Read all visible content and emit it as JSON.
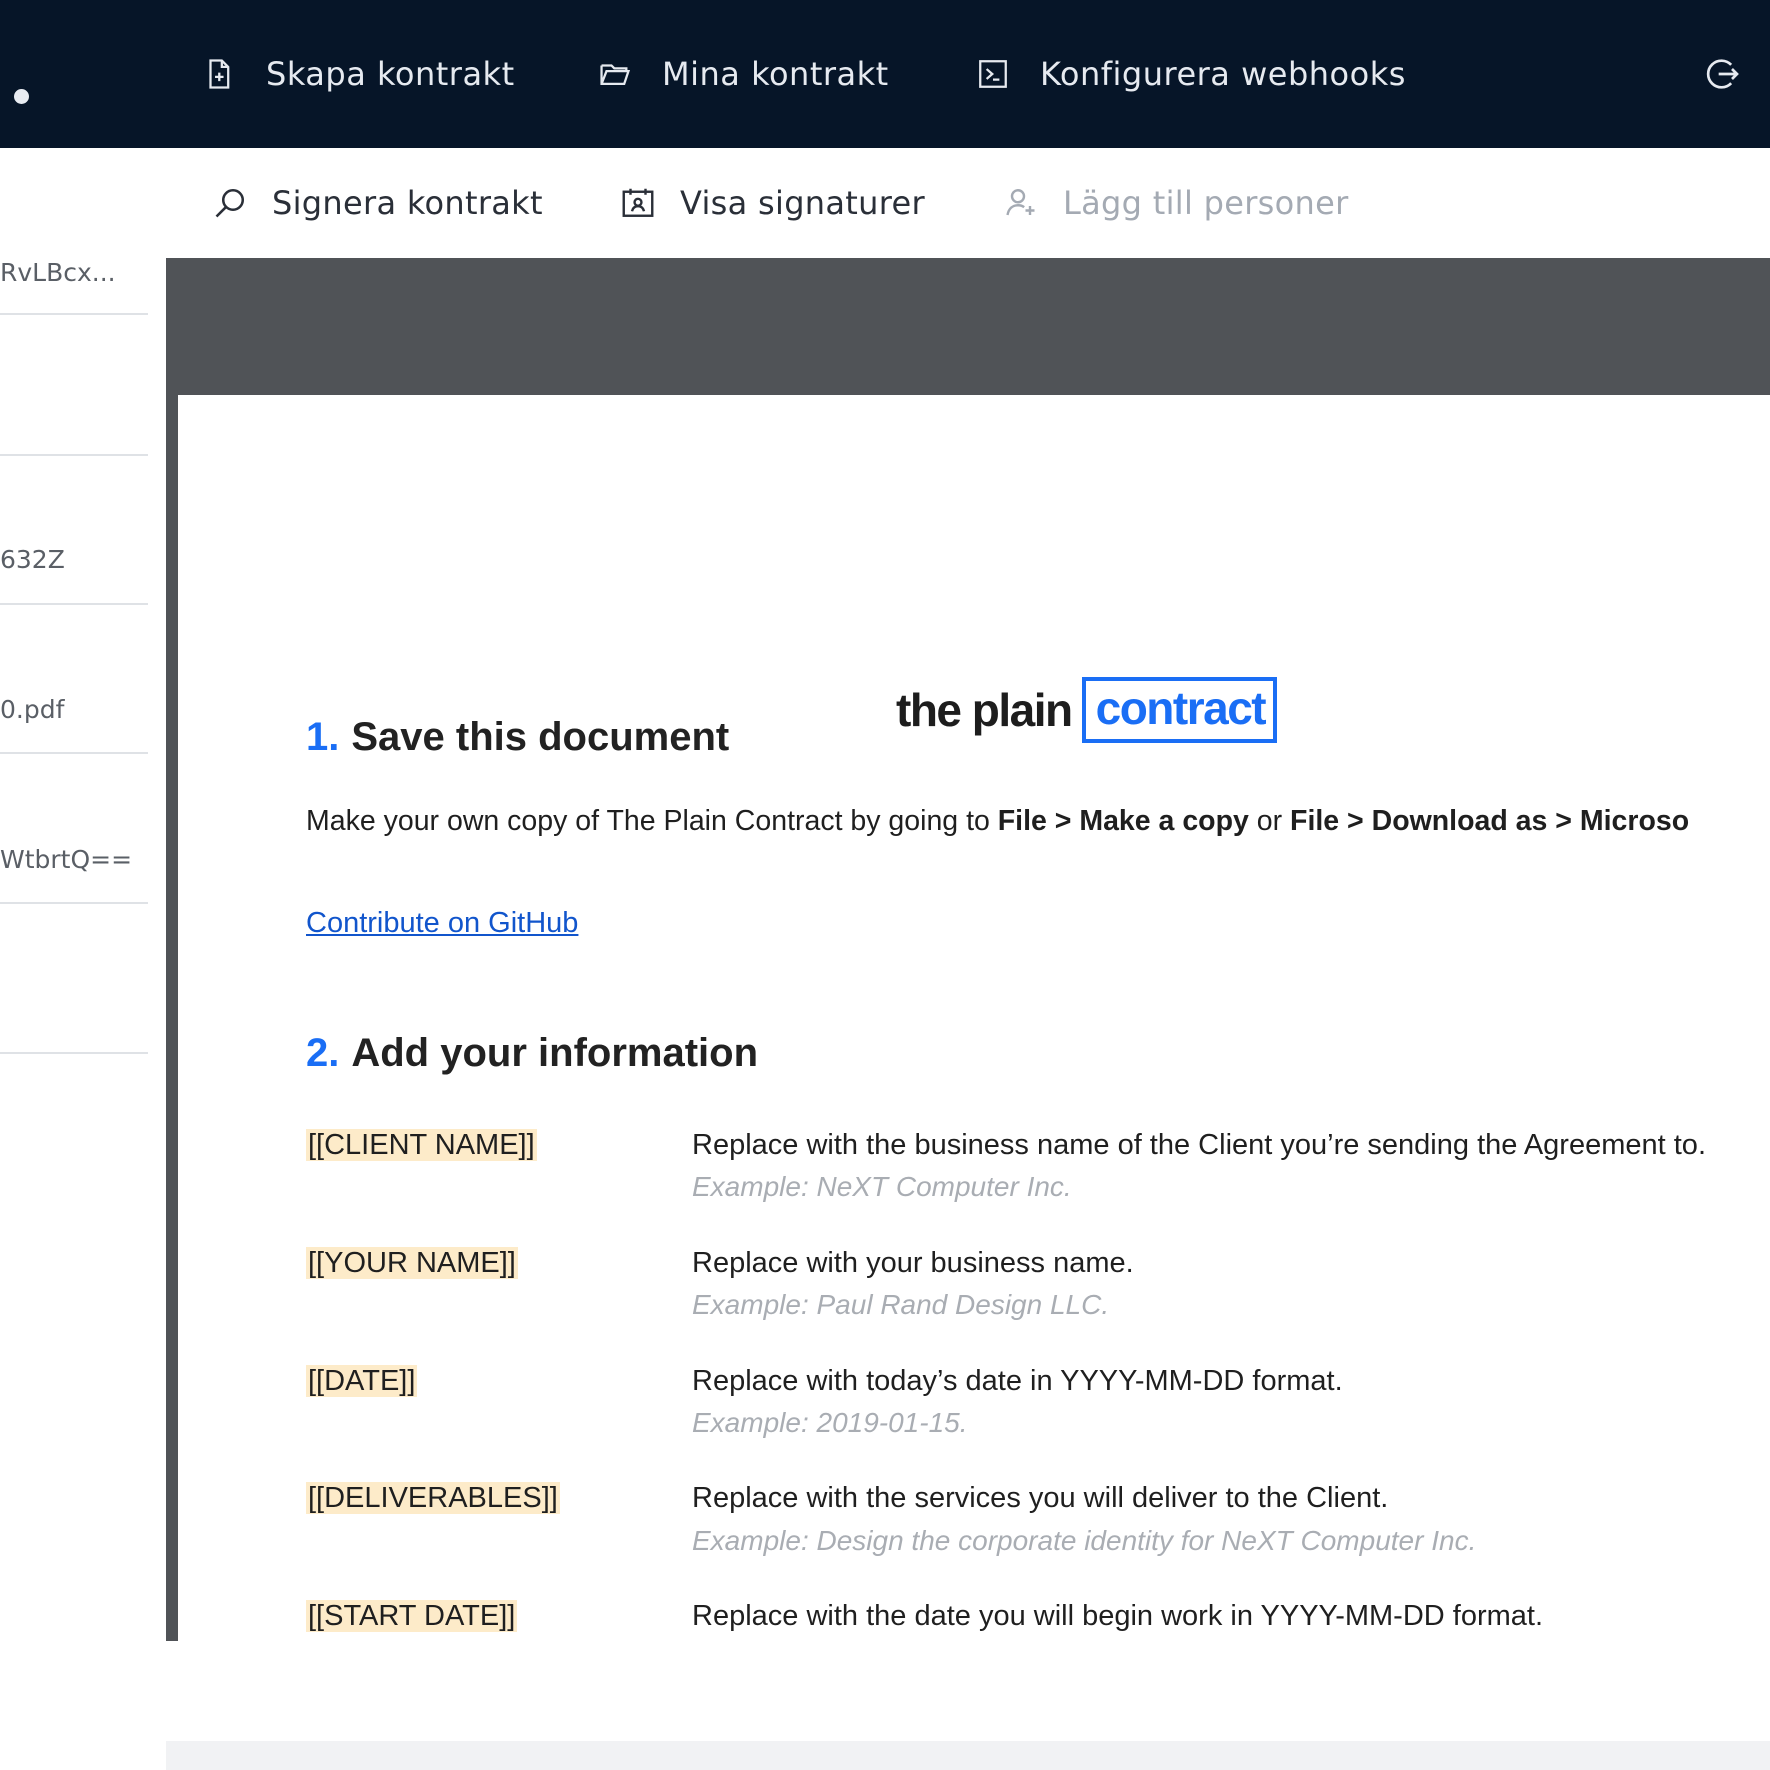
{
  "topnav": {
    "items": [
      {
        "label": "Skapa kontrakt",
        "icon": "new-document-icon"
      },
      {
        "label": "Mina kontrakt",
        "icon": "folder-icon"
      },
      {
        "label": "Konfigurera webhooks",
        "icon": "terminal-icon"
      }
    ],
    "logout_icon": "logout-icon"
  },
  "toolbar": {
    "items": [
      {
        "label": "Signera kontrakt",
        "icon": "magnifier-icon"
      },
      {
        "label": "Visa signaturer",
        "icon": "calendar-person-icon"
      },
      {
        "label": "Lägg till personer",
        "icon": "add-person-icon",
        "disabled": true
      }
    ]
  },
  "sidebar": {
    "values": [
      "RvLBcx...",
      "",
      "632Z",
      "0.pdf",
      "WtbrtQ==",
      ""
    ]
  },
  "document": {
    "logo_part1": "the plain",
    "logo_part2": "contract",
    "section1": {
      "number": "1.",
      "title": "Save this document"
    },
    "intro": {
      "t1": "Make your own copy of The Plain Contract by going to ",
      "b1": "File > Make a copy",
      "t2": " or ",
      "b2": "File > Download as > Microso"
    },
    "link": "Contribute on GitHub",
    "section2": {
      "number": "2.",
      "title": "Add your information"
    },
    "fields": [
      {
        "tag": "[[CLIENT NAME]]",
        "desc": "Replace with the business name of the Client you’re sending the Agreement to.",
        "example": "Example: NeXT Computer Inc."
      },
      {
        "tag": "[[YOUR NAME]]",
        "desc": "Replace with your business name.",
        "example": "Example: Paul Rand Design LLC."
      },
      {
        "tag": "[[DATE]]",
        "desc": "Replace with today’s date in YYYY-MM-DD format.",
        "example": "Example: 2019-01-15."
      },
      {
        "tag": "[[DELIVERABLES]]",
        "desc": "Replace with the services you will deliver to the Client.",
        "example": "Example: Design the corporate identity for NeXT Computer Inc."
      },
      {
        "tag": "[[START DATE]]",
        "desc": "Replace with the date you will begin work in YYYY-MM-DD format.",
        "example": ""
      }
    ]
  },
  "colors": {
    "nav_bg": "#061528",
    "accent": "#1a6ef5",
    "link": "#1155cc",
    "tag_highlight": "#fdebc9",
    "viewer_bg": "#505357"
  }
}
